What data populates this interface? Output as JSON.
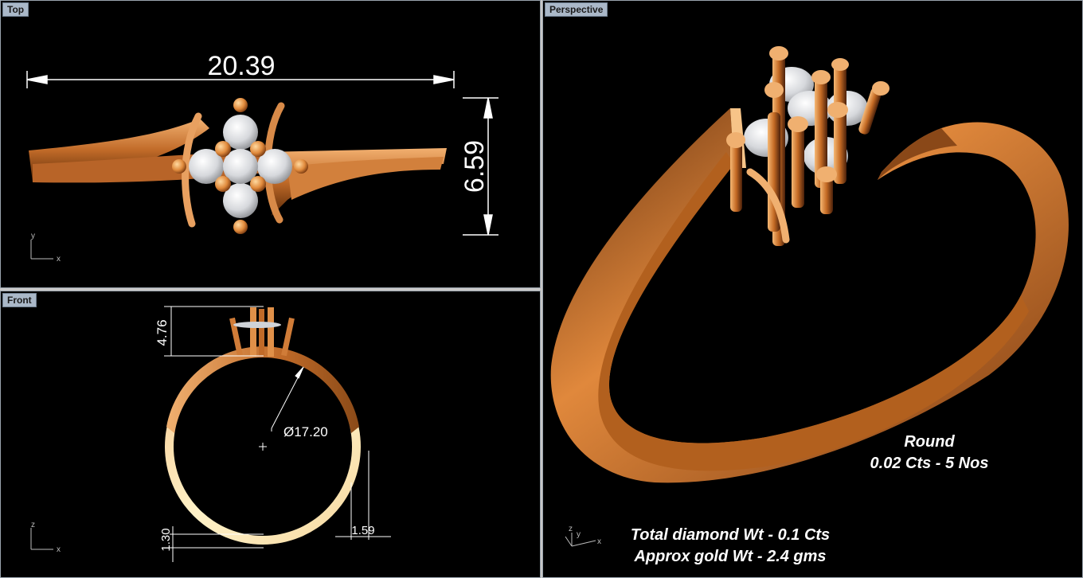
{
  "viewports": {
    "top": {
      "label": "Top"
    },
    "front": {
      "label": "Front"
    },
    "perspective": {
      "label": "Perspective"
    }
  },
  "dimensions": {
    "top_width": "20.39",
    "top_height": "6.59",
    "front_head_height": "4.76",
    "front_diameter": "Ø17.20",
    "front_band_bottom": "1.30",
    "front_band_width": "1.59"
  },
  "axes": {
    "top": {
      "v": "y",
      "h": "x"
    },
    "front": {
      "v": "z",
      "h": "x"
    },
    "perspective": {
      "v": "z",
      "h": "x",
      "d": "y"
    }
  },
  "notes": {
    "stone_shape": "Round",
    "stone_detail": "0.02 Cts - 5 Nos",
    "total_diamond": "Total diamond Wt - 0.1 Cts",
    "gold_weight": "Approx gold Wt - 2.4 gms"
  },
  "colors": {
    "background": "#000000",
    "label_bg": "#aab8c8",
    "gold": "#e39a55",
    "gold_light": "#f7d8a0",
    "diamond": "#d8dade"
  }
}
